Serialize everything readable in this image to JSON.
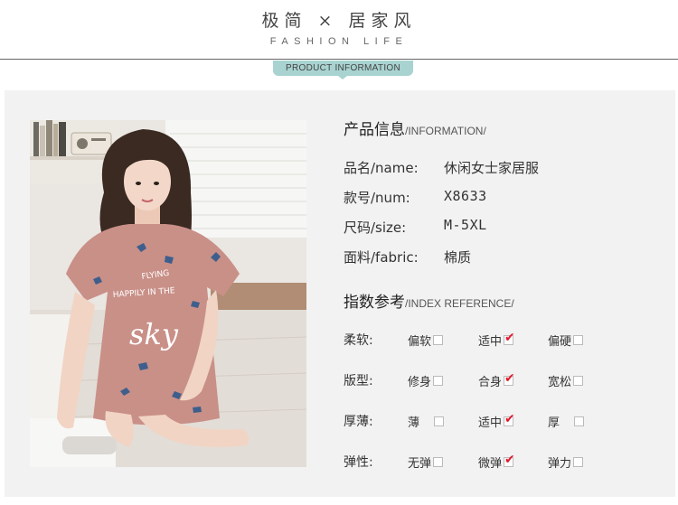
{
  "header": {
    "title": "极简 × 居家风",
    "subtitle": "FASHION LIFE",
    "tag": "PRODUCT INFORMATION"
  },
  "product_info": {
    "heading": "产品信息",
    "heading_en": "/INFORMATION/",
    "rows": [
      {
        "label": "品名/name:",
        "value": "休闲女士家居服"
      },
      {
        "label": "款号/num:",
        "value": "X8633"
      },
      {
        "label": "尺码/size:",
        "value": "M-5XL"
      },
      {
        "label": "面料/fabric:",
        "value": "棉质"
      }
    ]
  },
  "index_reference": {
    "heading": "指数参考",
    "heading_en": "/INDEX REFERENCE/",
    "rows": [
      {
        "label": "柔软:",
        "options": [
          "偏软",
          "适中",
          "偏硬"
        ],
        "selected": 1
      },
      {
        "label": "版型:",
        "options": [
          "修身",
          "合身",
          "宽松"
        ],
        "selected": 1
      },
      {
        "label": "厚薄:",
        "options": [
          "薄",
          "适中",
          "厚"
        ],
        "selected": 1
      },
      {
        "label": "弹性:",
        "options": [
          "无弹",
          "微弹",
          "弹力"
        ],
        "selected": 1
      }
    ]
  },
  "photo": {
    "shirt_text_1": "FLYING",
    "shirt_text_2": "HAPPILY IN THE",
    "shirt_text_3": "sky",
    "colors": {
      "dress": "#c99088",
      "hair": "#3a2a22",
      "skin": "#f1d4c4",
      "accent_check": "#e0192e"
    }
  }
}
